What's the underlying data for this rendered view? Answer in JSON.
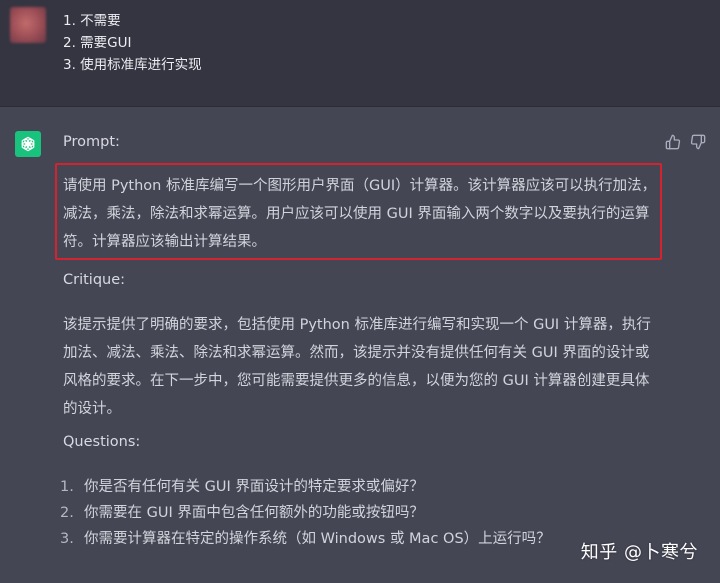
{
  "user_message": {
    "lines": [
      "1. 不需要",
      "2. 需要GUI",
      "3. 使用标准库进行实现"
    ]
  },
  "assistant": {
    "prompt_label": "Prompt:",
    "prompt_lines": [
      "请使用 Python 标准库编写一个图形用户界面（GUI）计算器。该计算器应该可以执行加法，",
      "减法，乘法，除法和求幂运算。用户应该可以使用 GUI 界面输入两个数字以及要执行的运算",
      "符。计算器应该输出计算结果。"
    ],
    "critique_label": "Critique:",
    "critique_lines": [
      "该提示提供了明确的要求，包括使用 Python 标准库进行编写和实现一个 GUI 计算器，执行",
      "加法、减法、乘法、除法和求幂运算。然而，该提示并没有提供任何有关 GUI 界面的设计或",
      "风格的要求。在下一步中，您可能需要提供更多的信息，以便为您的 GUI 计算器创建更具体",
      "的设计。"
    ],
    "questions_label": "Questions:",
    "questions": [
      {
        "num": "1.",
        "text": "你是否有任何有关 GUI 界面设计的特定要求或偏好？"
      },
      {
        "num": "2.",
        "text": "你需要在 GUI 界面中包含任何额外的功能或按钮吗？"
      },
      {
        "num": "3.",
        "text": "你需要计算器在特定的操作系统（如 Windows 或 Mac OS）上运行吗？"
      }
    ],
    "feedback_icons": [
      "thumbs-up-icon",
      "thumbs-down-icon"
    ]
  },
  "watermark": "知乎 @卜寒兮",
  "colors": {
    "user_bg": "#343541",
    "assistant_bg": "#444654",
    "openai_green": "#19c37d",
    "highlight_red": "#d4232f"
  }
}
